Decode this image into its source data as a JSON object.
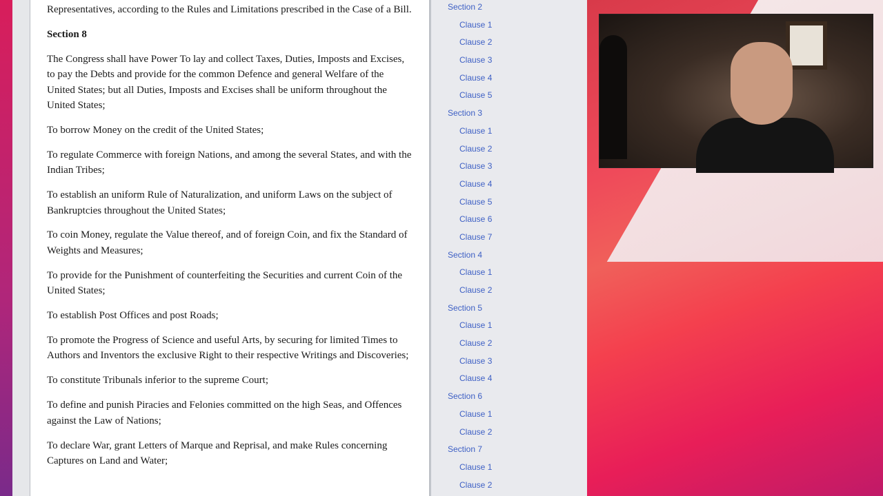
{
  "document": {
    "paragraphs": [
      {
        "text": "Representatives, according to the Rules and Limitations prescribed in the Case of a Bill.",
        "heading": false
      },
      {
        "text": "Section 8",
        "heading": true
      },
      {
        "text": "The Congress shall have Power To lay and collect Taxes, Duties, Imposts and Excises, to pay the Debts and provide for the common Defence and general Welfare of the United States; but all Duties, Imposts and Excises shall be uniform throughout the United States;",
        "heading": false
      },
      {
        "text": "To borrow Money on the credit of the United States;",
        "heading": false
      },
      {
        "text": "To regulate Commerce with foreign Nations, and among the several States, and with the Indian Tribes;",
        "heading": false
      },
      {
        "text": "To establish an uniform Rule of Naturalization, and uniform Laws on the subject of Bankruptcies throughout the United States;",
        "heading": false
      },
      {
        "text": "To coin Money, regulate the Value thereof, and of foreign Coin, and fix the Standard of Weights and Measures;",
        "heading": false
      },
      {
        "text": "To provide for the Punishment of counterfeiting the Securities and current Coin of the United States;",
        "heading": false
      },
      {
        "text": "To establish Post Offices and post Roads;",
        "heading": false
      },
      {
        "text": "To promote the Progress of Science and useful Arts, by securing for limited Times to Authors and Inventors the exclusive Right to their respective Writings and Discoveries;",
        "heading": false
      },
      {
        "text": "To constitute Tribunals inferior to the supreme Court;",
        "heading": false
      },
      {
        "text": "To define and punish Piracies and Felonies committed on the high Seas, and Offences against the Law of Nations;",
        "heading": false
      },
      {
        "text": "To declare War, grant Letters of Marque and Reprisal, and make Rules concerning Captures on Land and Water;",
        "heading": false
      }
    ]
  },
  "toc": [
    {
      "label": "Section 2",
      "type": "sec"
    },
    {
      "label": "Clause 1",
      "type": "cl"
    },
    {
      "label": "Clause 2",
      "type": "cl"
    },
    {
      "label": "Clause 3",
      "type": "cl"
    },
    {
      "label": "Clause 4",
      "type": "cl"
    },
    {
      "label": "Clause 5",
      "type": "cl"
    },
    {
      "label": "Section 3",
      "type": "sec"
    },
    {
      "label": "Clause 1",
      "type": "cl"
    },
    {
      "label": "Clause 2",
      "type": "cl"
    },
    {
      "label": "Clause 3",
      "type": "cl"
    },
    {
      "label": "Clause 4",
      "type": "cl"
    },
    {
      "label": "Clause 5",
      "type": "cl"
    },
    {
      "label": "Clause 6",
      "type": "cl"
    },
    {
      "label": "Clause 7",
      "type": "cl"
    },
    {
      "label": "Section 4",
      "type": "sec"
    },
    {
      "label": "Clause 1",
      "type": "cl"
    },
    {
      "label": "Clause 2",
      "type": "cl"
    },
    {
      "label": "Section 5",
      "type": "sec"
    },
    {
      "label": "Clause 1",
      "type": "cl"
    },
    {
      "label": "Clause 2",
      "type": "cl"
    },
    {
      "label": "Clause 3",
      "type": "cl"
    },
    {
      "label": "Clause 4",
      "type": "cl"
    },
    {
      "label": "Section 6",
      "type": "sec"
    },
    {
      "label": "Clause 1",
      "type": "cl"
    },
    {
      "label": "Clause 2",
      "type": "cl"
    },
    {
      "label": "Section 7",
      "type": "sec"
    },
    {
      "label": "Clause 1",
      "type": "cl"
    },
    {
      "label": "Clause 2",
      "type": "cl"
    }
  ]
}
